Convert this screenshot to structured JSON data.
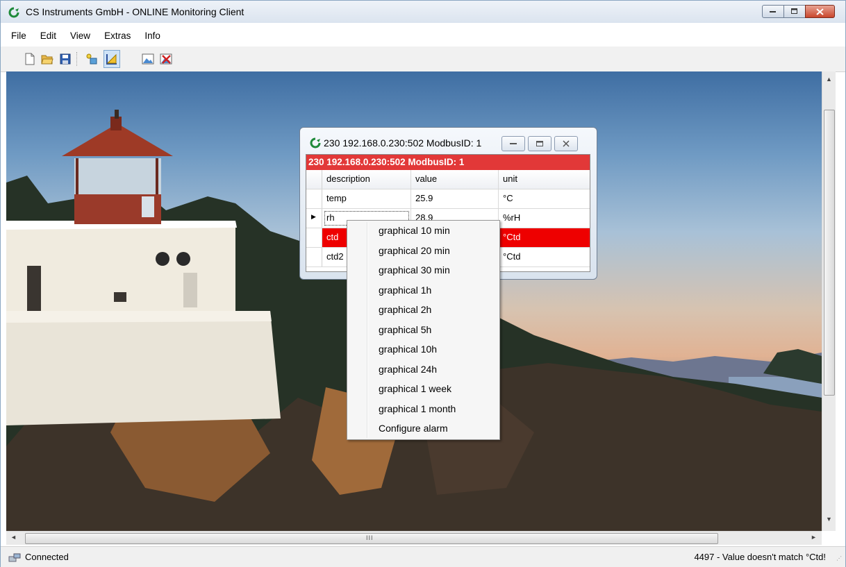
{
  "app": {
    "title": "CS Instruments GmbH - ONLINE Monitoring Client"
  },
  "menu": [
    "File",
    "Edit",
    "View",
    "Extras",
    "Info"
  ],
  "toolbar": {
    "icons": [
      "new-document-icon",
      "open-folder-icon",
      "save-icon",
      "add-device-icon",
      "graph-tool-icon",
      "picture-icon",
      "remove-picture-icon"
    ]
  },
  "child_window": {
    "title": "230 192.168.0.230:502 ModbusID: 1",
    "header": "230 192.168.0.230:502 ModbusID: 1",
    "columns": [
      "description",
      "value",
      "unit"
    ],
    "rows": [
      {
        "description": "temp",
        "value": "25.9",
        "unit": "°C",
        "alarm": false
      },
      {
        "description": "rh",
        "value": "28.9",
        "unit": "%rH",
        "alarm": false,
        "current": true
      },
      {
        "description": "ctd",
        "value": "",
        "unit": "°Ctd",
        "alarm": true
      },
      {
        "description": "ctd2",
        "value": "",
        "unit": "°Ctd",
        "alarm": false
      }
    ]
  },
  "context_menu": [
    "graphical 10 min",
    "graphical 20 min",
    "graphical 30 min",
    "graphical 1h",
    "graphical 2h",
    "graphical 5h",
    "graphical 10h",
    "graphical 24h",
    "graphical 1 week",
    "graphical 1 month",
    "Configure alarm"
  ],
  "scrollbar": {
    "grip": "III"
  },
  "status": {
    "left": "Connected",
    "right": "4497 - Value doesn't match °Ctd!"
  },
  "colors": {
    "alarm": "#ee0000",
    "header": "#e23838"
  }
}
